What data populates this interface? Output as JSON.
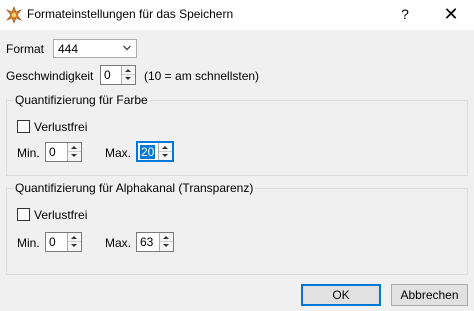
{
  "window": {
    "title": "Formateinstellungen für das Speichern",
    "help_label": "?",
    "close_label": "✕"
  },
  "format": {
    "label": "Format",
    "value": "444"
  },
  "speed": {
    "label": "Geschwindigkeit",
    "value": "0",
    "hint": "(10 = am schnellsten)"
  },
  "color_group": {
    "title": "Quantifizierung für Farbe",
    "lossless_label": "Verlustfrei",
    "lossless_checked": false,
    "min_label": "Min.",
    "min_value": "0",
    "max_label": "Max.",
    "max_value": "20"
  },
  "alpha_group": {
    "title": "Quantifizierung für Alphakanal (Transparenz)",
    "lossless_label": "Verlustfrei",
    "lossless_checked": false,
    "min_label": "Min.",
    "min_value": "0",
    "max_label": "Max.",
    "max_value": "63"
  },
  "buttons": {
    "ok_label": "OK",
    "cancel_label": "Abbrechen"
  },
  "colors": {
    "accent": "#0078d7",
    "background": "#f0f0f0"
  }
}
